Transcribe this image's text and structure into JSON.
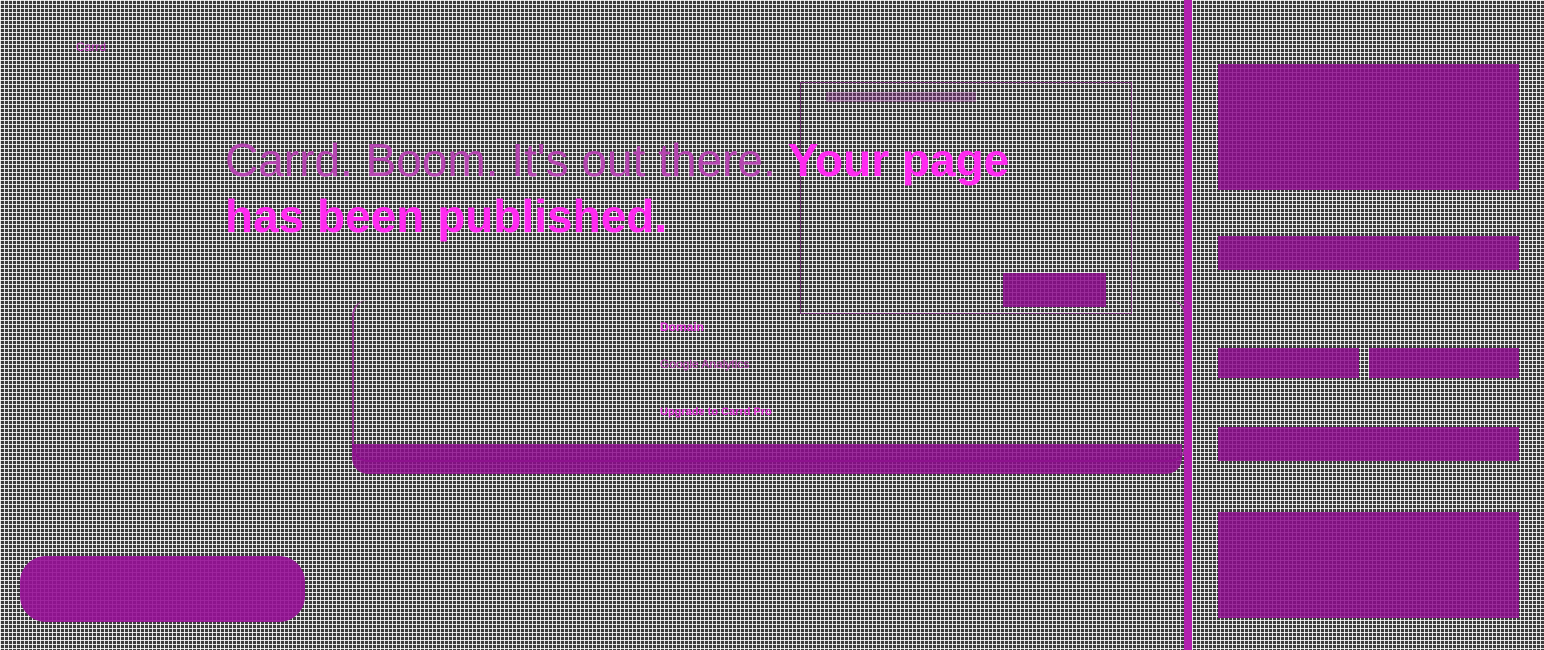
{
  "header": {
    "logo_text": "Carrd"
  },
  "headline": {
    "dim_part": "Carrd. Boom. It's out there.",
    "bright_part": "Your page has been published."
  },
  "card": {
    "item1": "Domain",
    "item2": "Google Analytics",
    "item3": "Upgrade to Carrd Pro"
  },
  "colors": {
    "accent": "#ff2af0",
    "panel": "#8c0a8c",
    "divider": "#b21fae",
    "background": "#3c3c3c"
  }
}
